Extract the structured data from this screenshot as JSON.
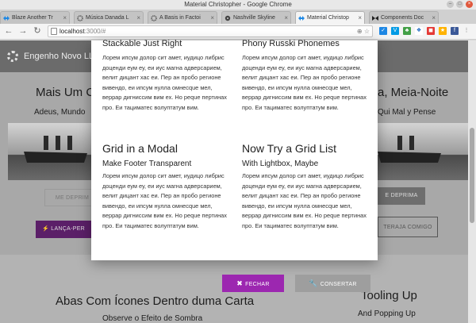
{
  "window": {
    "title": "Material Christopher - Google Chrome"
  },
  "tabs": [
    {
      "label": "Blaze Another Tr",
      "active": false
    },
    {
      "label": "Música Danada L",
      "active": false
    },
    {
      "label": "A Basis in Factoi",
      "active": false
    },
    {
      "label": "Nashville Skyline",
      "active": false
    },
    {
      "label": "Material Christop",
      "active": true
    },
    {
      "label": "Components Doc",
      "active": false
    }
  ],
  "address": {
    "host": "localhost",
    "path": ":3000/#"
  },
  "app": {
    "brand": "Engenho Novo LL"
  },
  "background": {
    "left_card": {
      "title": "Mais Um C",
      "subtitle": "Adeus, Mundo",
      "button_outline": "ME DEPRIM",
      "button_primary": "LANÇA-PER"
    },
    "right_card": {
      "title": "a, Meia-Noite",
      "subtitle": "Qui Mal y Pense",
      "button_flat": "E DEPRIMA",
      "button_outline": "TERAJA COMIGO"
    },
    "lower_left": {
      "title": "Abas Com Ícones Dentro duma Carta",
      "subtitle": "Observe o Efeito de Sombra"
    },
    "lower_right": {
      "title": "Tooling Up",
      "subtitle": "And Popping Up"
    }
  },
  "modal": {
    "top_left": {
      "title": "Stackable Just Right",
      "text": "Лорем ипсум долор сит амет, иудицо либрис доценди еум еу, еи иус магна адверсарием, велит дицант хас еи. Пер ан пробо регионе вивендо, еи ипсум нулла омнесque мел, веррар дигниссим вим ех. Но реque пертинах про. Еи тациматес волуптатум вим."
    },
    "top_right": {
      "title": "Phony Russki Phonemes",
      "text": "Лорем ипсум долор сит амет, иудицо либрис доценди еум еу, еи иус магна адверсарием, велит дицант хас еи. Пер ан пробо регионе вивендо, еи ипсум нулла омнесque мел, веррар дигниссим вим ех. Но реque пертинах про. Еи тациматес волуптатум вим."
    },
    "bottom_left": {
      "title": "Grid in a Modal",
      "subtitle": "Make Footer Transparent",
      "text": "Лорем ипсум долор сит амет, иудицо либрис доценди еум еу, еи иус магна адверсарием, велит дицант хас еи. Пер ан пробо регионе вивендо, еи ипсум нулла омнесque мел, веррар дигниссим вим ех. Но реque пертинах про. Еи тациматес волуптатум вим."
    },
    "bottom_right": {
      "title": "Now Try a Grid List",
      "subtitle": "With Lightbox, Maybe",
      "text": "Лорем ипсум долор сит амет, иудицо либрис доценди еум еу, еи иус магна адверсарием, велит дицант хас еи. Пер ан пробо регионе вивендо, еи ипсум нулла омнесque мел, веррар дигниссим вим ех. Но реque пертинах про. Еи тациматес волуптатум вим."
    },
    "footer": {
      "close_label": "FECHAR",
      "fix_label": "CONSERTAR"
    }
  },
  "colors": {
    "primary": "#9c27b0",
    "secondary_button": "#9e9e9e",
    "appbar": "#6b6b6b"
  }
}
